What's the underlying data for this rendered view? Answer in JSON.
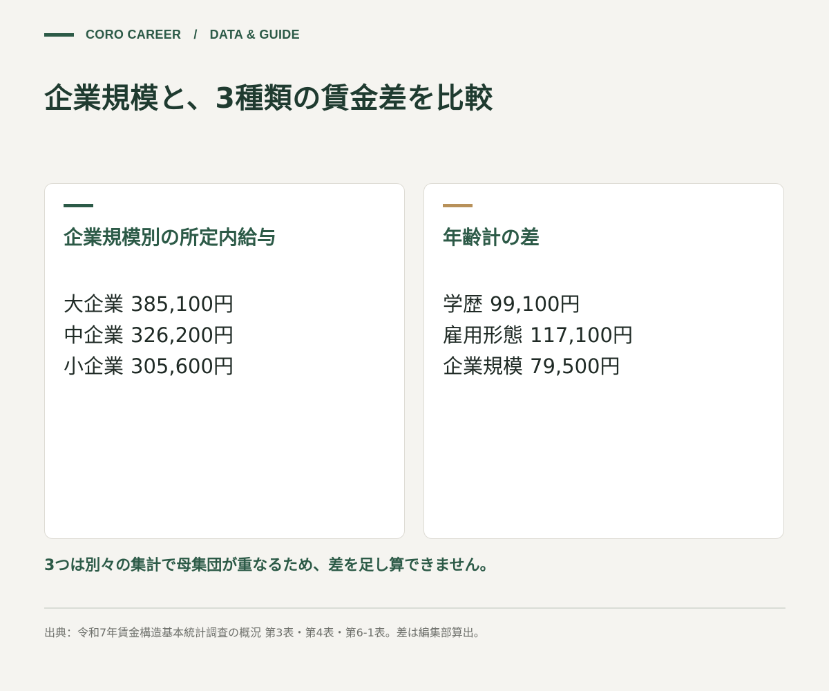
{
  "header": {
    "brand": "CORO CAREER",
    "separator": "/",
    "section": "DATA & GUIDE"
  },
  "title": "企業規模と、3種類の賃金差を比較",
  "colors": {
    "primary_green": "#2c5a47",
    "accent_gold": "#b8915a"
  },
  "cards": [
    {
      "title": "企業規模別の所定内給与",
      "accent_color": "#2c5a47",
      "items": [
        {
          "label": "大企業",
          "value": "385,100円"
        },
        {
          "label": "中企業",
          "value": "326,200円"
        },
        {
          "label": "小企業",
          "value": "305,600円"
        }
      ]
    },
    {
      "title": "年齢計の差",
      "accent_color": "#b8915a",
      "items": [
        {
          "label": "学歴",
          "value": "99,100円"
        },
        {
          "label": "雇用形態",
          "value": "117,100円"
        },
        {
          "label": "企業規模",
          "value": "79,500円"
        }
      ]
    }
  ],
  "note": "3つは別々の集計で母集団が重なるため、差を足し算できません。",
  "source": "出典：令和7年賃金構造基本統計調査の概況 第3表・第4表・第6-1表。差は編集部算出。"
}
